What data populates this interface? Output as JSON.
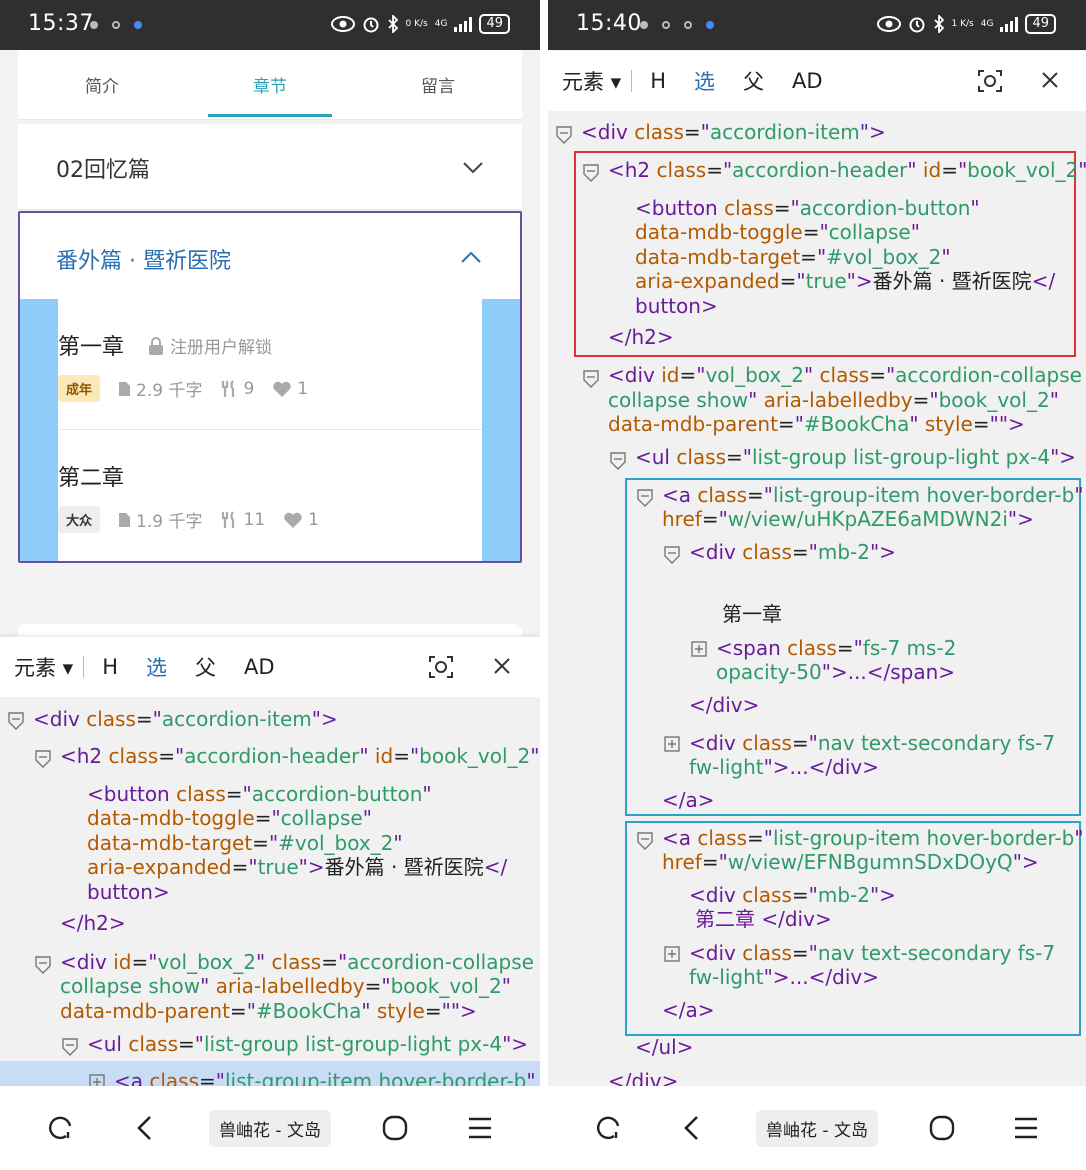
{
  "left": {
    "status": {
      "time": "15:37",
      "net_speed": "0 K/s",
      "network": "4G",
      "battery": "49"
    },
    "tabs": [
      {
        "label": "简介"
      },
      {
        "label": "章节"
      },
      {
        "label": "留言"
      }
    ],
    "volume1": {
      "title": "02回忆篇"
    },
    "volume2": {
      "title": "番外篇 · 暨祈医院"
    },
    "chapters": [
      {
        "name": "第一章",
        "lock_text": "注册用户解锁",
        "badge": "成年",
        "words": "2.9 千字",
        "comments": "9",
        "likes": "1"
      },
      {
        "name": "第二章",
        "badge": "大众",
        "words": "1.9 千字",
        "comments": "11",
        "likes": "1"
      }
    ],
    "nav_app": "兽岫花 - 文岛"
  },
  "right": {
    "status": {
      "time": "15:40",
      "net_speed": "1 K/s",
      "network": "4G",
      "battery": "49"
    },
    "nav_app": "兽岫花 - 文岛"
  },
  "devtools": {
    "toolbar": {
      "elements": "元素",
      "h": "H",
      "select": "选",
      "parent": "父",
      "ad": "AD"
    }
  },
  "code": {
    "div_open": "<div",
    "class": "class",
    "eq": "=",
    "q": "\"",
    "gt": ">",
    "accordion_item": "accordion-item",
    "h2_open": "<h2",
    "accordion_header": "accordion-header",
    "id": "id",
    "book_vol_2": "book_vol_2",
    "button_open": "<button",
    "accordion_button": "accordion-button",
    "data_mdb_toggle": "data-mdb-toggle",
    "collapse": "collapse",
    "data_mdb_target": "data-mdb-target",
    "vol_box_target": "#vol_box_2",
    "aria_expanded": "aria-expanded",
    "true": "true",
    "button_text": "番外篇 · 暨祈医院",
    "lt_slash": "</",
    "button": "button",
    "h2_close": "</h2>",
    "vol_box_2": "vol_box_2",
    "accordion_collapse": "accordion-collapse",
    "collapse_show": "collapse show",
    "aria_labelledby": "aria-labelledby",
    "data_mdb_parent": "data-mdb-parent",
    "bookcha": "#BookCha",
    "style": "style",
    "empty": "",
    "ul_open": "<ul",
    "list_group": "list-group list-group-light px-4",
    "a_open": "<a",
    "list_group_item": "list-group-item hover-border-b",
    "href": "href",
    "href1": "w/view/uHKpAZE6aMDWN2i",
    "href2": "w/view/EFNBgumnSDxDOyQ",
    "mb2": "mb-2",
    "chapter1": "第一章",
    "chapter2": "第二章",
    "span_open": "<span",
    "span_class_a": "fs-7 ms-2",
    "span_class_b": "opacity-50",
    "ellipsis_span": ">...</span>",
    "div_close": "</div>",
    "a_close": "</a>",
    "ul_close": "</ul>",
    "nav_class_a": "nav text-secondary fs-7",
    "nav_class_b": "fw-light",
    "ellipsis_div": ">...</div>",
    "chapter2_div_close": "第二章 </div>"
  },
  "colors": {
    "tag": "#6a1b9a",
    "attr": "#b35a00",
    "value": "#2e9a6a",
    "active_tab": "#2aa3b8",
    "red_box": "#e0303a",
    "blue_box": "#2aa3c8",
    "purple_border": "#6650a0"
  }
}
